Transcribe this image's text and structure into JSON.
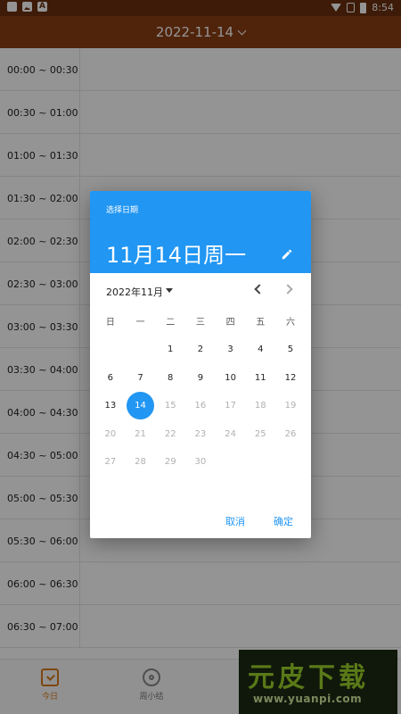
{
  "status_bar": {
    "time": "8:54",
    "icons": [
      "square-icon",
      "image-icon",
      "a-icon",
      "wifi-icon",
      "no-sim-icon",
      "battery-icon"
    ]
  },
  "app_bar": {
    "date": "2022-11-14"
  },
  "schedule": {
    "slots": [
      "00:00 ~ 00:30",
      "00:30 ~ 01:00",
      "01:00 ~ 01:30",
      "01:30 ~ 02:00",
      "02:00 ~ 02:30",
      "02:30 ~ 03:00",
      "03:00 ~ 03:30",
      "03:30 ~ 04:00",
      "04:00 ~ 04:30",
      "04:30 ~ 05:00",
      "05:00 ~ 05:30",
      "05:30 ~ 06:00",
      "06:00 ~ 06:30",
      "06:30 ~ 07:00"
    ]
  },
  "bottom_nav": {
    "items": [
      {
        "label": "今日",
        "icon": "calendar-check-icon"
      },
      {
        "label": "周小结",
        "icon": "summary-icon"
      }
    ]
  },
  "watermark": {
    "text": "元皮下载",
    "url": "www.yuanpi.com"
  },
  "date_picker": {
    "helper": "选择日期",
    "selected_date": "11月14日周一",
    "month_label": "2022年11月",
    "weekdays": [
      "日",
      "一",
      "二",
      "三",
      "四",
      "五",
      "六"
    ],
    "weeks": [
      [
        "",
        "",
        "1",
        "2",
        "3",
        "4",
        "5"
      ],
      [
        "6",
        "7",
        "8",
        "9",
        "10",
        "11",
        "12"
      ],
      [
        "13",
        "14",
        "15",
        "16",
        "17",
        "18",
        "19"
      ],
      [
        "20",
        "21",
        "22",
        "23",
        "24",
        "25",
        "26"
      ],
      [
        "27",
        "28",
        "29",
        "30",
        "",
        "",
        ""
      ]
    ],
    "selected_day": "14",
    "last_enabled_day": 14,
    "cancel_label": "取消",
    "ok_label": "确定",
    "colors": {
      "accent": "#2196f3",
      "app_bar": "#8a3d14",
      "nav_active": "#d97a1c"
    }
  }
}
